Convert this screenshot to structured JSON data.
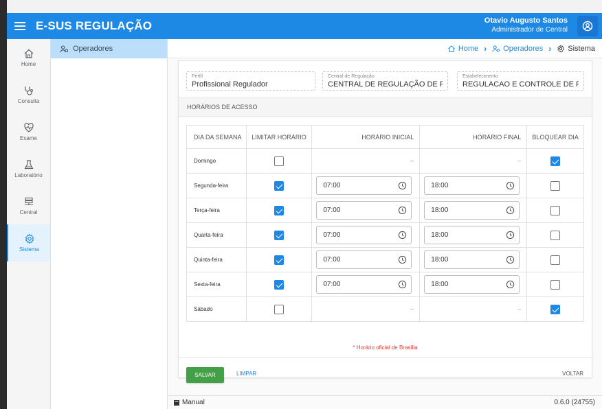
{
  "app": {
    "title": "E-SUS REGULAÇÃO"
  },
  "user": {
    "name": "Otavio Augusto Santos",
    "role": "Administrador de Central"
  },
  "rail": [
    {
      "label": "Home",
      "icon": "home-icon"
    },
    {
      "label": "Consulta",
      "icon": "stethoscope-icon"
    },
    {
      "label": "Exame",
      "icon": "heart-pulse-icon"
    },
    {
      "label": "Laboratório",
      "icon": "flask-icon"
    },
    {
      "label": "Central",
      "icon": "server-icon"
    },
    {
      "label": "Sistema",
      "icon": "gear-icon"
    }
  ],
  "subnav": {
    "item": "Operadores"
  },
  "breadcrumb": {
    "home": "Home",
    "operadores": "Operadores",
    "sistema": "Sistema"
  },
  "form": {
    "perfil_label": "Perfil",
    "perfil_value": "Profissional Regulador",
    "central_label": "Central de Regulação",
    "central_value": "CENTRAL DE REGULAÇÃO DE PINDAI",
    "estab_label": "Estabelecimento",
    "estab_value": "REGULACAO E CONTROLE DE PINDAI"
  },
  "section": {
    "title": "HORÁRIOS DE ACESSO"
  },
  "table": {
    "headers": {
      "day": "DIA DA SEMANA",
      "limit": "LIMITAR HORÁRIO",
      "start": "HORÁRIO INICIAL",
      "end": "HORÁRIO FINAL",
      "block": "BLOQUEAR DIA"
    },
    "rows": [
      {
        "day": "Domingo",
        "limit": false,
        "start": "--",
        "end": "--",
        "block": true
      },
      {
        "day": "Segunda-feira",
        "limit": true,
        "start": "07:00",
        "end": "18:00",
        "block": false
      },
      {
        "day": "Terça-feira",
        "limit": true,
        "start": "07:00",
        "end": "18:00",
        "block": false
      },
      {
        "day": "Quarta-feira",
        "limit": true,
        "start": "07:00",
        "end": "18:00",
        "block": false
      },
      {
        "day": "Quinta-feira",
        "limit": true,
        "start": "07:00",
        "end": "18:00",
        "block": false
      },
      {
        "day": "Sexta-feira",
        "limit": true,
        "start": "07:00",
        "end": "18:00",
        "block": false
      },
      {
        "day": "Sábado",
        "limit": false,
        "start": "--",
        "end": "--",
        "block": true
      }
    ]
  },
  "footnote": "* Horário oficial de Brasília",
  "actions": {
    "save": "SALVAR",
    "clear": "LIMPAR",
    "back": "VOLTAR"
  },
  "footer": {
    "manual": "Manual",
    "version": "0.6.0 (24755)"
  },
  "colors": {
    "primary": "#1e88e5",
    "save": "#43a047",
    "accent_red": "#e53935"
  }
}
